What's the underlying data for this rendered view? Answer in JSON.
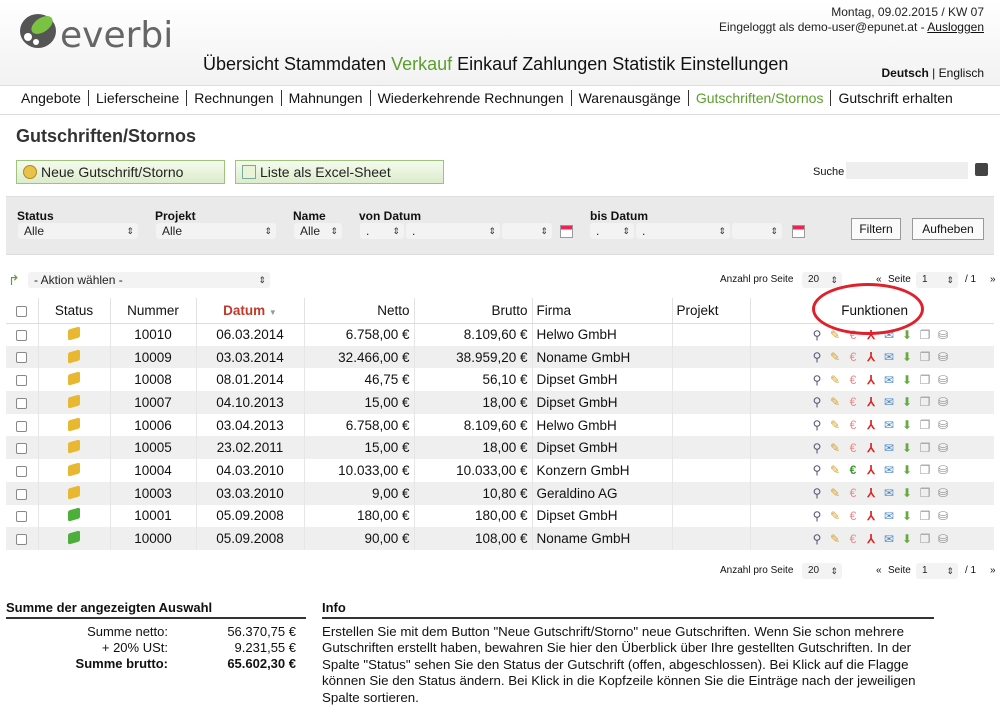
{
  "header": {
    "logo": "everbill",
    "date": "Montag, 09.02.2015 / KW 07",
    "login": "Eingeloggt als demo-user@epunet.at -",
    "logout": "Ausloggen",
    "lang_de": "Deutsch",
    "lang_sep": "|",
    "lang_en": "Englisch"
  },
  "mainnav": [
    "Übersicht",
    "Stammdaten",
    "Verkauf",
    "Einkauf",
    "Zahlungen",
    "Statistik",
    "Einstellungen"
  ],
  "subnav": [
    "Angebote",
    "Lieferscheine",
    "Rechnungen",
    "Mahnungen",
    "Wiederkehrende Rechnungen",
    "Warenausgänge",
    "Gutschriften/Stornos",
    "Gutschrift erhalten"
  ],
  "page_title": "Gutschriften/Stornos",
  "buttons": {
    "new": "Neue Gutschrift/Storno",
    "excel": "Liste als Excel-Sheet",
    "search_label": "Suche",
    "filter": "Filtern",
    "reset": "Aufheben"
  },
  "filter": {
    "status_label": "Status",
    "status_value": "Alle",
    "projekt_label": "Projekt",
    "projekt_value": "Alle",
    "name_label": "Name",
    "name_value": "Alle",
    "von_label": "von Datum",
    "bis_label": "bis Datum",
    "dot": "."
  },
  "aktion": "- Aktion wählen -",
  "paging": {
    "per_page_label": "Anzahl pro Seite",
    "per_page": "20",
    "prefix": "«",
    "seite": "Seite",
    "page": "1",
    "of": "/ 1",
    "next": "»"
  },
  "columns": [
    "Status",
    "Nummer",
    "Datum",
    "Netto",
    "Brutto",
    "Firma",
    "Projekt",
    "Funktionen"
  ],
  "rows": [
    {
      "flag": "yellow",
      "nummer": "10010",
      "datum": "06.03.2014",
      "netto": "6.758,00 €",
      "brutto": "8.109,60 €",
      "firma": "Helwo GmbH",
      "projekt": "",
      "paid": false
    },
    {
      "flag": "yellow",
      "nummer": "10009",
      "datum": "03.03.2014",
      "netto": "32.466,00 €",
      "brutto": "38.959,20 €",
      "firma": "Noname GmbH",
      "projekt": "",
      "paid": false
    },
    {
      "flag": "yellow",
      "nummer": "10008",
      "datum": "08.01.2014",
      "netto": "46,75 €",
      "brutto": "56,10 €",
      "firma": "Dipset GmbH",
      "projekt": "",
      "paid": false
    },
    {
      "flag": "yellow",
      "nummer": "10007",
      "datum": "04.10.2013",
      "netto": "15,00 €",
      "brutto": "18,00 €",
      "firma": "Dipset GmbH",
      "projekt": "",
      "paid": false
    },
    {
      "flag": "yellow",
      "nummer": "10006",
      "datum": "03.04.2013",
      "netto": "6.758,00 €",
      "brutto": "8.109,60 €",
      "firma": "Helwo GmbH",
      "projekt": "",
      "paid": false
    },
    {
      "flag": "yellow",
      "nummer": "10005",
      "datum": "23.02.2011",
      "netto": "15,00 €",
      "brutto": "18,00 €",
      "firma": "Dipset GmbH",
      "projekt": "",
      "paid": false
    },
    {
      "flag": "yellow",
      "nummer": "10004",
      "datum": "04.03.2010",
      "netto": "10.033,00 €",
      "brutto": "10.033,00 €",
      "firma": "Konzern GmbH",
      "projekt": "",
      "paid": true
    },
    {
      "flag": "yellow",
      "nummer": "10003",
      "datum": "03.03.2010",
      "netto": "9,00 €",
      "brutto": "10,80 €",
      "firma": "Geraldino AG",
      "projekt": "",
      "paid": false
    },
    {
      "flag": "green",
      "nummer": "10001",
      "datum": "05.09.2008",
      "netto": "180,00 €",
      "brutto": "180,00 €",
      "firma": "Dipset GmbH",
      "projekt": "",
      "paid": false
    },
    {
      "flag": "green",
      "nummer": "10000",
      "datum": "05.09.2008",
      "netto": "90,00 €",
      "brutto": "108,00 €",
      "firma": "Noname GmbH",
      "projekt": "",
      "paid": false
    }
  ],
  "summary": {
    "title": "Summe der angezeigten Auswahl",
    "netto_label": "Summe netto:",
    "netto": "56.370,75 €",
    "ust_label": "+ 20% USt:",
    "ust": "9.231,55 €",
    "brutto_label": "Summe brutto:",
    "brutto": "65.602,30 €"
  },
  "info": {
    "title": "Info",
    "text": "Erstellen Sie mit dem Button \"Neue Gutschrift/Storno\" neue Gutschriften. Wenn Sie schon mehrere Gutschriften erstellt haben, bewahren Sie hier den Überblick über Ihre gestellten Gutschriften. In der Spalte \"Status\" sehen Sie den Status der Gutschrift (offen, abgeschlossen). Bei Klick auf die Flagge können Sie den Status ändern. Bei Klick in die Kopfzeile können Sie die Einträge nach der jeweiligen Spalte sortieren."
  },
  "colors": {
    "accent": "#5c9e2e",
    "sort": "#c0392b",
    "highlight": "#e0202a",
    "flag_yellow": "#e8b830",
    "flag_green": "#4caf3a"
  }
}
